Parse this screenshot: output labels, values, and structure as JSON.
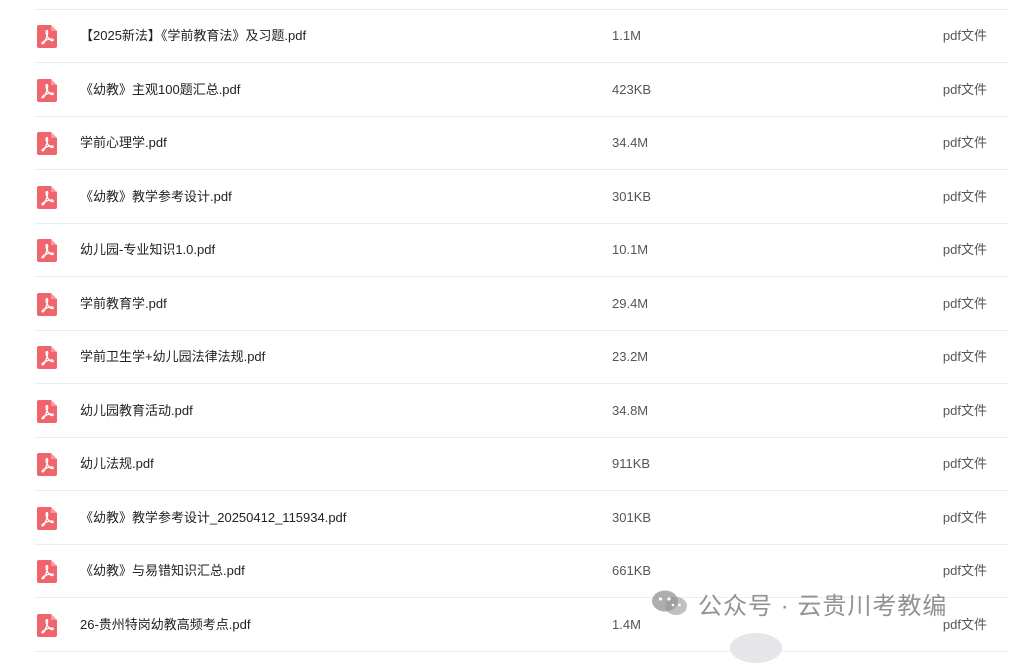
{
  "files": [
    {
      "name": "【2025新法】《学前教育法》及习题.pdf",
      "size": "1.1M",
      "type": "pdf文件"
    },
    {
      "name": "《幼教》主观100题汇总.pdf",
      "size": "423KB",
      "type": "pdf文件"
    },
    {
      "name": "学前心理学.pdf",
      "size": "34.4M",
      "type": "pdf文件"
    },
    {
      "name": "《幼教》教学参考设计.pdf",
      "size": "301KB",
      "type": "pdf文件"
    },
    {
      "name": "幼儿园-专业知识1.0.pdf",
      "size": "10.1M",
      "type": "pdf文件"
    },
    {
      "name": "学前教育学.pdf",
      "size": "29.4M",
      "type": "pdf文件"
    },
    {
      "name": "学前卫生学+幼儿园法律法规.pdf",
      "size": "23.2M",
      "type": "pdf文件"
    },
    {
      "name": "幼儿园教育活动.pdf",
      "size": "34.8M",
      "type": "pdf文件"
    },
    {
      "name": "幼儿法规.pdf",
      "size": "911KB",
      "type": "pdf文件"
    },
    {
      "name": "《幼教》教学参考设计_20250412_115934.pdf",
      "size": "301KB",
      "type": "pdf文件"
    },
    {
      "name": "《幼教》与易错知识汇总.pdf",
      "size": "661KB",
      "type": "pdf文件"
    },
    {
      "name": "26-贵州特岗幼教高频考点.pdf",
      "size": "1.4M",
      "type": "pdf文件"
    }
  ],
  "file_icon": "pdf-file-icon",
  "colors": {
    "pdf_icon": "#f0656b",
    "divider": "#eeeeee",
    "text": "#222222",
    "muted_text": "#555555"
  },
  "watermark": {
    "text": "公众号 · 云贵川考教编",
    "icon": "wechat-icon"
  }
}
